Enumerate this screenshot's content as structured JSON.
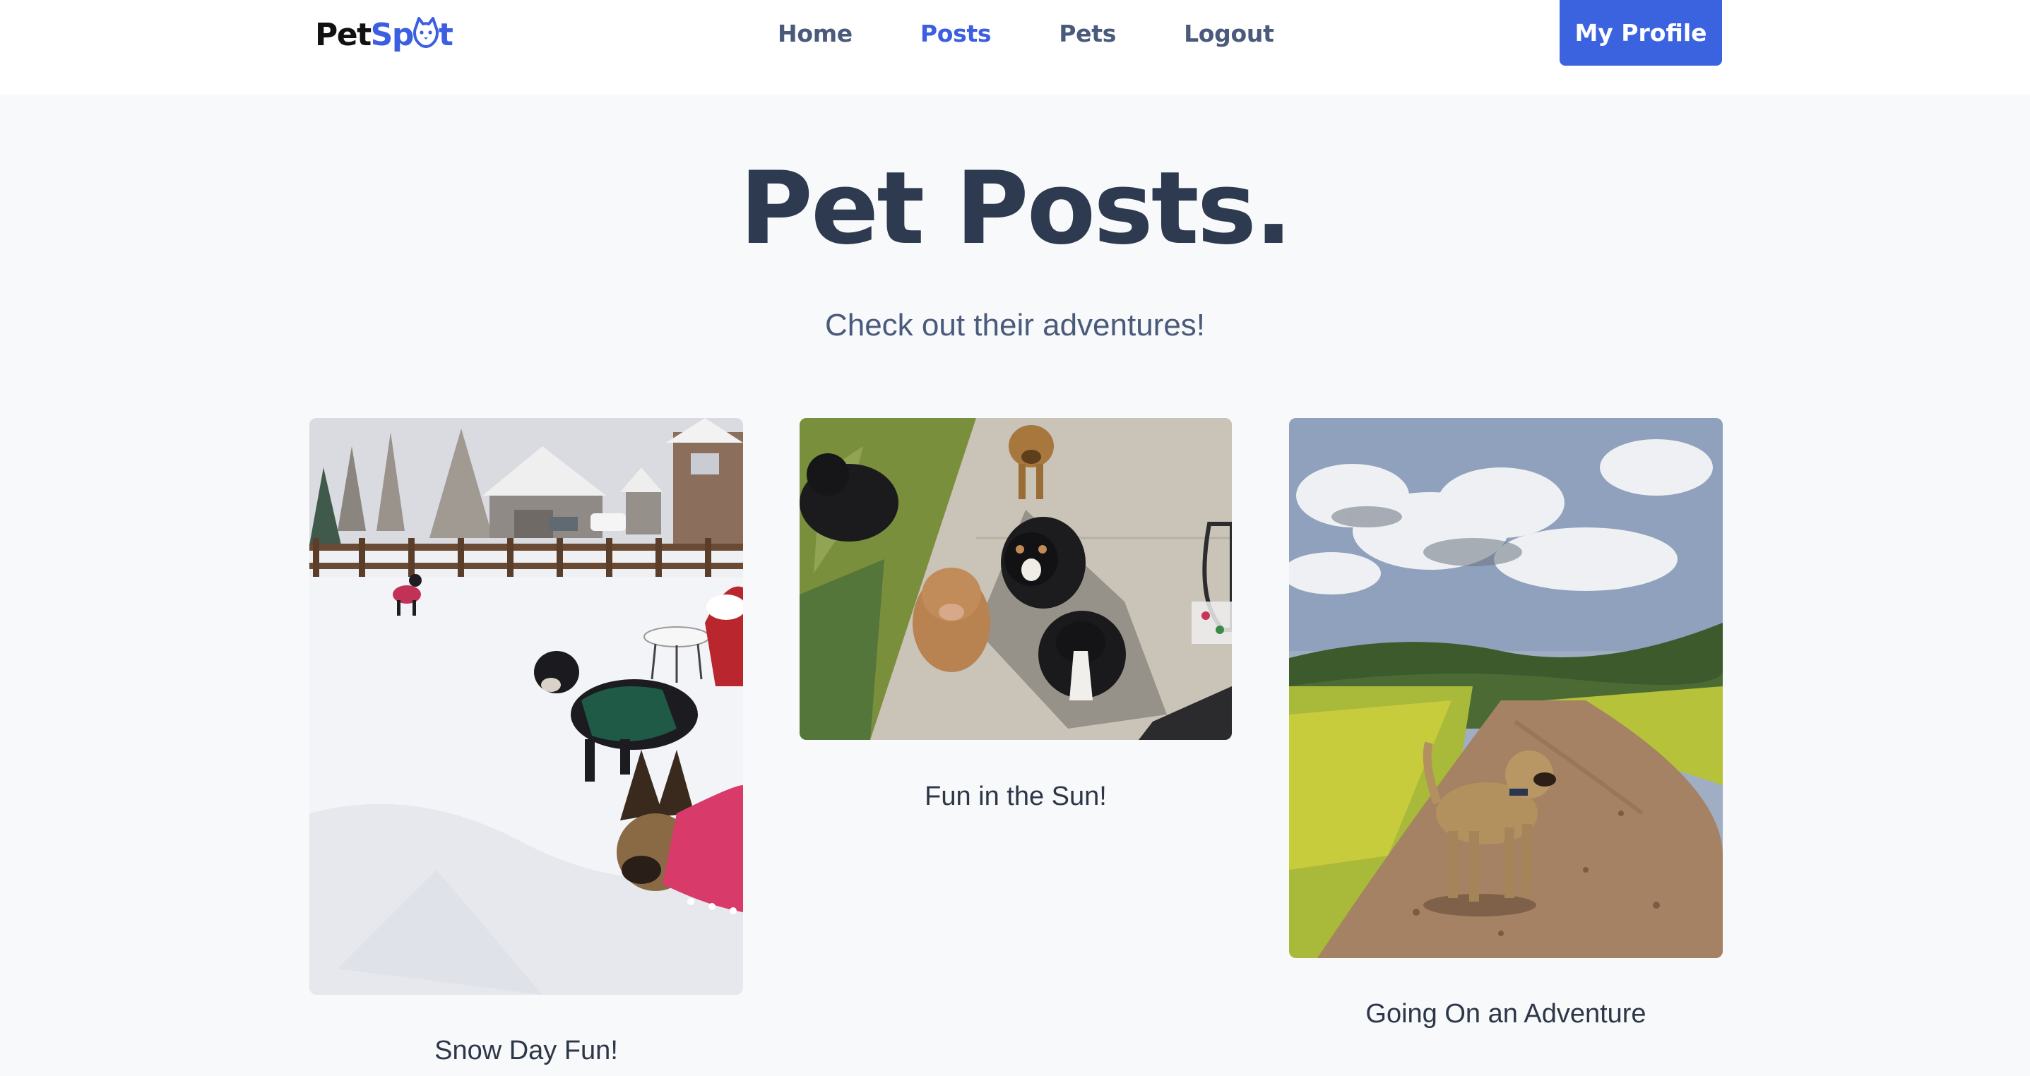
{
  "header": {
    "logo": {
      "part1": "Pet",
      "part2": "Sp",
      "part3": "t"
    },
    "nav": [
      {
        "label": "Home",
        "active": false
      },
      {
        "label": "Posts",
        "active": true
      },
      {
        "label": "Pets",
        "active": false
      },
      {
        "label": "Logout",
        "active": false
      }
    ],
    "profile_button": "My Profile"
  },
  "hero": {
    "title": "Pet Posts.",
    "subtitle": "Check out their adventures!"
  },
  "posts": [
    {
      "caption": "Snow Day Fun!"
    },
    {
      "caption": "Fun in the Sun!"
    },
    {
      "caption": "Going On an Adventure"
    }
  ],
  "colors": {
    "accent": "#3b63e0",
    "page_background": "#f8f9fb",
    "heading": "#2d3a4f",
    "nav_text": "#4a5a7a"
  }
}
